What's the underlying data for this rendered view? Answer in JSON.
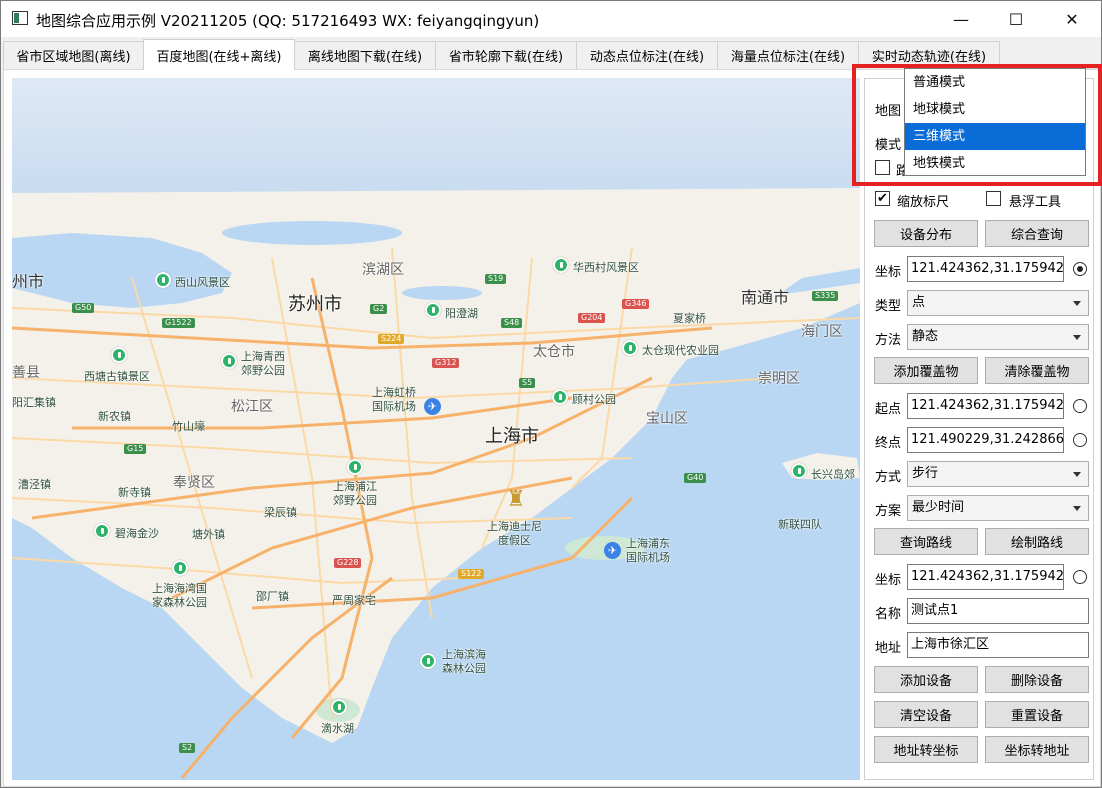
{
  "window": {
    "title": "地图综合应用示例 V20211205 (QQ: 517216493 WX: feiyangqingyun)",
    "minimize_glyph": "—",
    "maximize_glyph": "☐",
    "close_glyph": "✕"
  },
  "tabs": [
    {
      "label": "省市区域地图(离线)"
    },
    {
      "label": "百度地图(在线+离线)"
    },
    {
      "label": "离线地图下载(在线)"
    },
    {
      "label": "省市轮廓下载(在线)"
    },
    {
      "label": "动态点位标注(在线)"
    },
    {
      "label": "海量点位标注(在线)"
    },
    {
      "label": "实时动态轨迹(在线)"
    }
  ],
  "map": {
    "labels": {
      "zhou": "州市",
      "binhu": "滨湖区",
      "xishan": "西山风景区",
      "huaxicun": "华西村风景区",
      "nantong": "南通市",
      "suzhou": "苏州市",
      "yangcheng": "阳澄湖",
      "haimen": "海门区",
      "xiameiqiao": "夏家桥",
      "taicang": "太仓市",
      "taicang_farm": "太仓现代农业园",
      "xitang": "西塘古镇景区",
      "qingxi": "上海青西\n郊野公园",
      "shanxian": "善县",
      "chongming": "崇明区",
      "hongqiao": "上海虹桥\n国际机场",
      "songjiang": "松江区",
      "gucun": "顾村公园",
      "baoshan": "宝山区",
      "yangji": "阳汇集镇",
      "xinnong": "新农镇",
      "zhulin": "竹山壕",
      "shanghai": "上海市",
      "zhenjing": "漕泾镇",
      "xinsi": "新寺镇",
      "fengxian": "奉贤区",
      "pujiang": "上海浦江\n郊野公园",
      "changxing": "长兴岛郊",
      "xinlian": "新联四队",
      "disney": "上海迪士尼\n度假区",
      "liangchen": "梁辰镇",
      "bihai": "碧海金沙",
      "tangwai": "塘外镇",
      "pudong": "上海浦东\n国际机场",
      "haiwan": "上海海湾国\n家森林公园",
      "shaochang": "邵厂镇",
      "yanzhou": "严周家宅",
      "binhai": "上海滨海\n森林公园",
      "dishui": "滴水湖"
    },
    "shields": {
      "g50": "G50",
      "g2": "G2",
      "g312": "G312",
      "g1522": "G1522",
      "s224": "S224",
      "s5": "S5",
      "g15": "G15",
      "g40": "G40",
      "g228": "G228",
      "s122": "S122",
      "s2": "S2",
      "s19": "S19",
      "g346": "G346",
      "g204": "G204",
      "s48": "S48",
      "s335": "S335"
    },
    "colors": {
      "water": "#b9d7f3",
      "land": "#f4f1ea",
      "park": "#cfe8d5",
      "highway": "#f6b26b",
      "road": "#fbd9a6"
    }
  },
  "panel": {
    "map_label": "地图",
    "mode_label": "模式",
    "route_label": "路",
    "scale_check": "缩放标尺",
    "float_tool_check": "悬浮工具",
    "btn_device_dist": "设备分布",
    "btn_query_all": "综合查询",
    "coord_label": "坐标",
    "coord_value": "121.424362,31.175942",
    "type_label": "类型",
    "type_value": "点",
    "method_label": "方法",
    "method_value": "静态",
    "btn_add_overlay": "添加覆盖物",
    "btn_clear_overlay": "清除覆盖物",
    "start_label": "起点",
    "start_value": "121.424362,31.175942",
    "end_label": "终点",
    "end_value": "121.490229,31.242866",
    "way_label": "方式",
    "way_value": "步行",
    "plan_label": "方案",
    "plan_value": "最少时间",
    "btn_query_route": "查询路线",
    "btn_draw_route": "绘制路线",
    "coord2_label": "坐标",
    "coord2_value": "121.424362,31.175942",
    "name_label": "名称",
    "name_value": "测试点1",
    "addr_label": "地址",
    "addr_value": "上海市徐汇区",
    "btn_add_device": "添加设备",
    "btn_del_device": "删除设备",
    "btn_clear_device": "清空设备",
    "btn_reset_device": "重置设备",
    "btn_addr_to_coord": "地址转坐标",
    "btn_coord_to_addr": "坐标转地址"
  },
  "dropdown": {
    "items": [
      {
        "label": "普通模式"
      },
      {
        "label": "地球模式"
      },
      {
        "label": "三维模式"
      },
      {
        "label": "地铁模式"
      }
    ],
    "highlight_color": "#e42222"
  }
}
